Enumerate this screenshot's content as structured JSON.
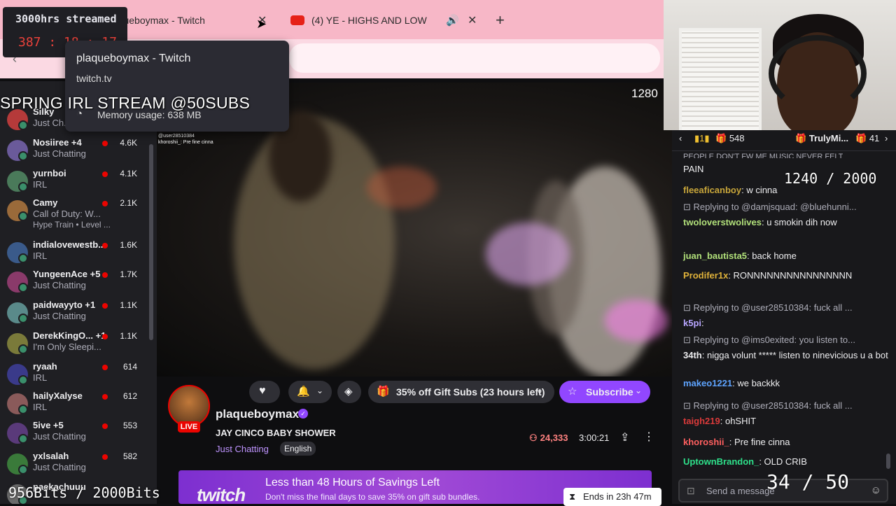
{
  "browser": {
    "tabs": [
      {
        "title": "plaqueboymax - Twitch"
      },
      {
        "title": "(4) YE - HIGHS AND LOW"
      }
    ],
    "tooltip": {
      "title": "plaqueboymax - Twitch",
      "url": "twitch.tv",
      "memory": "Memory usage: 638 MB"
    }
  },
  "overlay": {
    "timer_title": "3000hrs streamed",
    "timer_hours": "387",
    "timer_minutes": "18",
    "timer_seconds": "17",
    "stream_banner": "SPRING IRL STREAM @50SUBS",
    "resolution": "1280",
    "counter_top": "1240 / 2000",
    "counter_subs": "34 / 50",
    "counter_bits": "956Bits / 2000Bits"
  },
  "sidebar": {
    "channels": [
      {
        "name": "Silky",
        "category": "Just Ch...",
        "count": "",
        "extra": ""
      },
      {
        "name": "Nosiiree +4",
        "category": "Just Chatting",
        "count": "4.6K",
        "extra": ""
      },
      {
        "name": "yurnboi",
        "category": "IRL",
        "count": "4.1K",
        "extra": ""
      },
      {
        "name": "Camy",
        "category": "Call of Duty: W...",
        "count": "2.1K",
        "extra": "Hype Train • Level ..."
      },
      {
        "name": "indialovewestb...",
        "category": "IRL",
        "count": "1.6K",
        "extra": ""
      },
      {
        "name": "YungeenAce +5",
        "category": "Just Chatting",
        "count": "1.7K",
        "extra": ""
      },
      {
        "name": "paidwayyto +1",
        "category": "Just Chatting",
        "count": "1.1K",
        "extra": ""
      },
      {
        "name": "DerekKingO... +1",
        "category": "I'm Only Sleepi...",
        "count": "1.1K",
        "extra": ""
      },
      {
        "name": "ryaah",
        "category": "IRL",
        "count": "614",
        "extra": ""
      },
      {
        "name": "hailyXalyse",
        "category": "IRL",
        "count": "612",
        "extra": ""
      },
      {
        "name": "5ive +5",
        "category": "Just Chatting",
        "count": "553",
        "extra": ""
      },
      {
        "name": "yxlsalah",
        "category": "Just Chatting",
        "count": "582",
        "extra": ""
      },
      {
        "name": "paekachuuu",
        "category": "",
        "count": "",
        "extra": ""
      }
    ]
  },
  "video_chat_overlay": {
    "line1": "@user28510384",
    "line2": "khoroshii_: Pre fine cinna"
  },
  "stream": {
    "streamer": "plaqueboymax",
    "live": "LIVE",
    "title": "JAY CINCO BABY SHOWER",
    "category": "Just Chatting",
    "language": "English",
    "viewers": "24,333",
    "uptime": "3:00:21",
    "gift_subs_label": "35% off Gift Subs (23 hours left)",
    "subscribe_label": "Subscribe"
  },
  "promo": {
    "logo": "twitch",
    "headline": "Less than 48 Hours of Savings Left",
    "sub": "Don't miss the final days to save 35% on gift sub bundles.",
    "ends": "Ends in 23h 47m"
  },
  "chat": {
    "hype": {
      "count1": "548",
      "user": "TrulyMi...",
      "count2": "41"
    },
    "top_text": "PEOPLE DON'T FW ME MUSIC NEVER FELT",
    "messages": [
      {
        "type": "msg",
        "user": "",
        "text": "PAIN",
        "color": "#efeff1"
      },
      {
        "type": "msg",
        "user": "fleeaficanboy",
        "text": ": w cinna",
        "color": "#c7a53a"
      },
      {
        "type": "reply",
        "text": "Replying to @damjsquad: @bluehunni..."
      },
      {
        "type": "msg",
        "user": "twoloverstwolives",
        "text": ": u smokin dih now",
        "color": "#b1e07a"
      },
      {
        "type": "msg",
        "user": "juan_bautista5",
        "text": ": back home",
        "color": "#b1e07a"
      },
      {
        "type": "msg",
        "user": "Prodifer1x",
        "text": ": RONNNNNNNNNNNNNNNN",
        "color": "#e0b23a"
      },
      {
        "type": "reply",
        "text": "Replying to @user28510384: fuck all ..."
      },
      {
        "type": "msg",
        "user": "k5pi",
        "text": ":",
        "color": "#b7a5ff"
      },
      {
        "type": "reply",
        "text": "Replying to @ims0exited: you listen to..."
      },
      {
        "type": "msg",
        "user": "34th",
        "text": ": nigga volunt ***** listen to ninevicious u a bot",
        "color": "#efeff1"
      },
      {
        "type": "msg",
        "user": "makeo1221",
        "text": ": we backkk",
        "color": "#5ea4ff"
      },
      {
        "type": "reply",
        "text": "Replying to @user28510384: fuck all ..."
      },
      {
        "type": "msg",
        "user": "taigh219",
        "text": ": ohSHIT",
        "color": "#d93a3a"
      },
      {
        "type": "msg",
        "user": "khoroshii_",
        "text": ": Pre fine cinna",
        "color": "#ff5f5f"
      },
      {
        "type": "msg",
        "user": "UptownBrandon_",
        "text": ": OLD CRIB",
        "color": "#2ee08a"
      }
    ],
    "placeholder": "Send a message"
  }
}
